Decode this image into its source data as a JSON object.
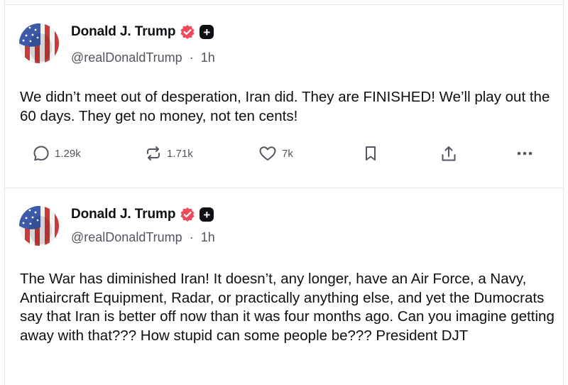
{
  "posts": [
    {
      "author": {
        "name": "Donald J. Trump",
        "handle": "@realDonaldTrump",
        "time": "1h"
      },
      "text": "We didn’t meet out of desperation, Iran did. They are FINISHED! We’ll play out the 60 days. They get no money, not ten cents!",
      "stats": {
        "replies": "1.29k",
        "retruths": "1.71k",
        "likes": "7k"
      }
    },
    {
      "author": {
        "name": "Donald J. Trump",
        "handle": "@realDonaldTrump",
        "time": "1h"
      },
      "text": "The War has diminished Iran! It doesn’t, any longer, have an Air Force, a Navy, Antiaircraft Equipment, Radar, or practically anything else, and yet the Dumocrats say that Iran is better off now than it was four months ago. Can you imagine getting away with that??? How stupid can some people be??? President DJT"
    }
  ],
  "separator": "·",
  "plus_glyph": "+",
  "icons": {
    "verified": "verified-badge-icon",
    "plus": "plus-badge-icon",
    "reply": "reply-icon",
    "retruth": "retruth-icon",
    "like": "heart-icon",
    "save": "bookmark-icon",
    "share": "share-icon",
    "more": "more-icon"
  },
  "colors": {
    "verified": "#ee4a5c",
    "text": "#0f0f14",
    "muted": "#55555f"
  }
}
